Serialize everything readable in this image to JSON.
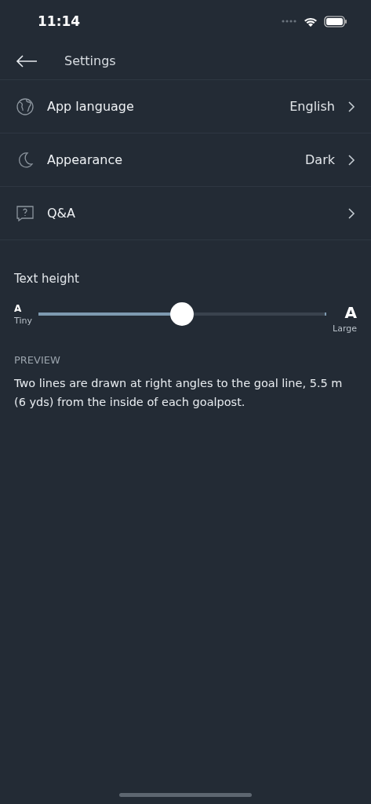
{
  "status_bar": {
    "time": "11:14"
  },
  "header": {
    "title": "Settings"
  },
  "rows": [
    {
      "kind": "globe",
      "label": "App language",
      "value": "English"
    },
    {
      "kind": "moon",
      "label": "Appearance",
      "value": "Dark"
    },
    {
      "kind": "question",
      "label": "Q&A"
    }
  ],
  "text_height": {
    "title": "Text height",
    "min_glyph": "A",
    "min_label": "Tiny",
    "max_glyph": "A",
    "max_label": "Large",
    "level": 0.5
  },
  "preview": {
    "heading": "PREVIEW",
    "text": "Two lines are drawn at right angles to the goal line, 5.5 m (6 yds) from the inside of each goalpost."
  }
}
